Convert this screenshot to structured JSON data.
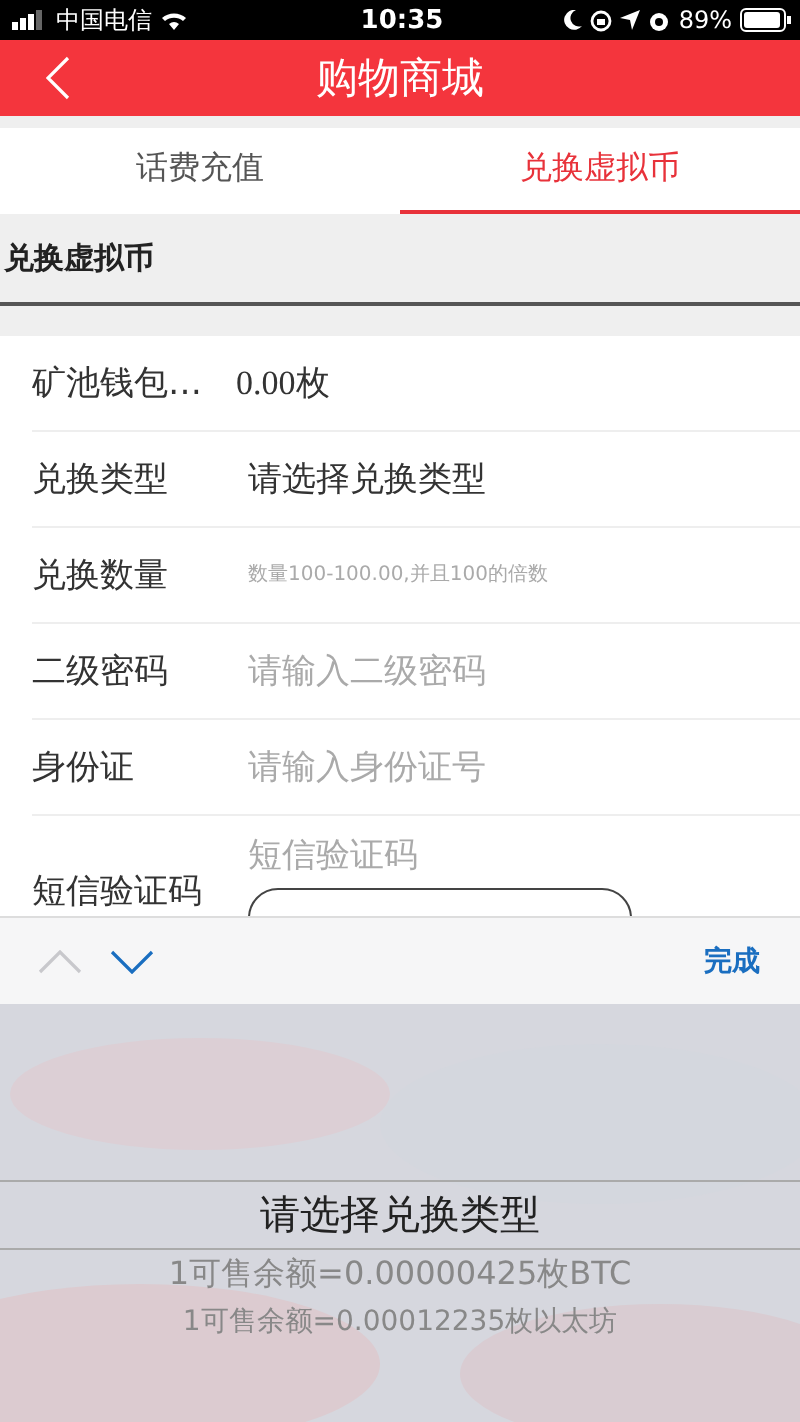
{
  "status_bar": {
    "carrier": "中国电信",
    "time": "10:35",
    "battery": "89%"
  },
  "header": {
    "title": "购物商城"
  },
  "tabs": [
    {
      "label": "话费充值",
      "selected": false
    },
    {
      "label": "兑换虚拟币",
      "selected": true
    }
  ],
  "section": {
    "title": "兑换虚拟币"
  },
  "form": [
    {
      "kind": "value",
      "label": "矿池钱包…",
      "value": "0.00枚"
    },
    {
      "kind": "select",
      "label": "兑换类型",
      "value": "请选择兑换类型"
    },
    {
      "kind": "input",
      "label": "兑换数量",
      "placeholder": "数量100-100.00,并且100的倍数",
      "small": true
    },
    {
      "kind": "input",
      "label": "二级密码",
      "placeholder": "请输入二级密码"
    },
    {
      "kind": "input",
      "label": "身份证",
      "placeholder": "请输入身份证号"
    },
    {
      "kind": "sms",
      "label": "短信验证码",
      "placeholder": "短信验证码"
    }
  ],
  "accessory_bar": {
    "previous_disabled": true,
    "next_disabled": false,
    "done": "完成"
  },
  "picker": {
    "options": [
      {
        "label": "请选择兑换类型",
        "selected": true
      },
      {
        "label": "1可售余额=0.00000425枚BTC",
        "selected": false
      },
      {
        "label": "1可售余额=0.00012235枚以太坊",
        "selected": false
      }
    ]
  }
}
